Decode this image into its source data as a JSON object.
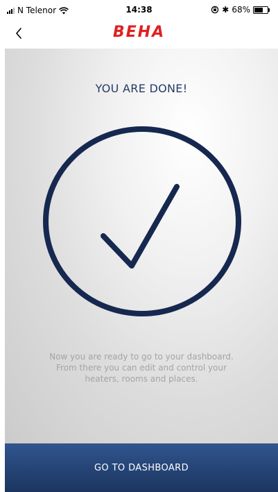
{
  "status_bar": {
    "carrier": "N Telenor",
    "time": "14:38",
    "bluetooth": "✱",
    "battery": "68%",
    "icons": [
      "signal-icon",
      "wifi-icon",
      "orientation-lock-icon",
      "bluetooth-icon",
      "battery-icon"
    ]
  },
  "nav": {
    "back_icon": "chevron-left-icon",
    "logo": "BEHA"
  },
  "main": {
    "title": "YOU ARE DONE!",
    "check_icon": "checkmark-circle-icon",
    "description": "Now you are ready to go to your dashboard.\nFrom there you can edit and control your\nheaters, rooms and places."
  },
  "footer": {
    "button_label": "GO TO DASHBOARD"
  },
  "colors": {
    "brand_red": "#e02020",
    "navy": "#16284f",
    "button_blue": "#25467a",
    "title_text": "#243a66",
    "description_text": "#a4a4a4"
  }
}
